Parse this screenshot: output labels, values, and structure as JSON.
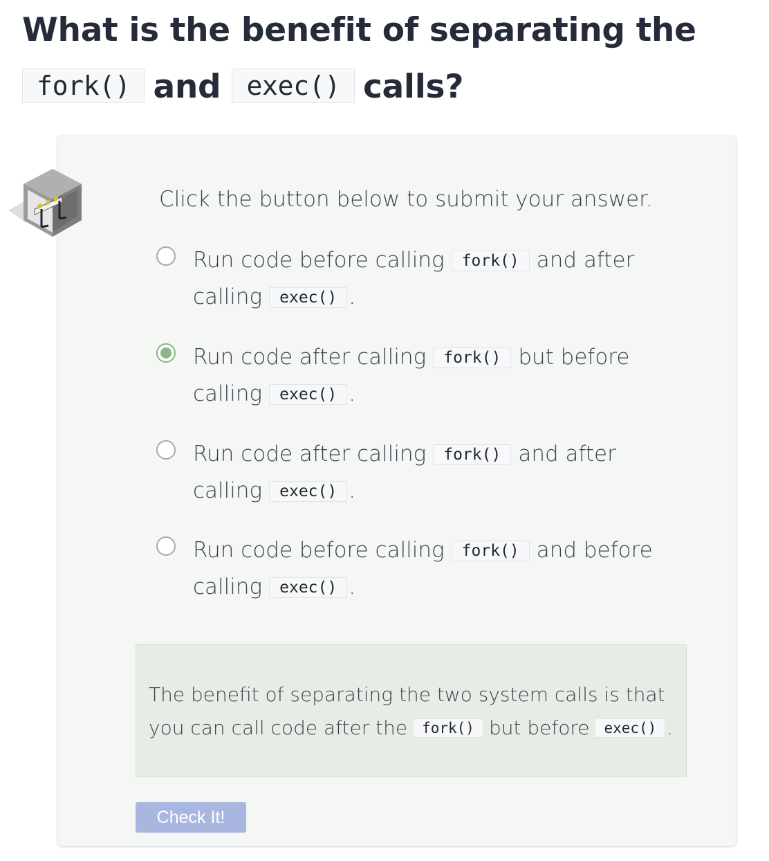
{
  "question": {
    "title_part1": "What is the benefit of separating the",
    "code1": "fork()",
    "title_and": "and",
    "code2": "exec()",
    "title_part2": "calls?"
  },
  "prompt": "Click the button below to submit your answer.",
  "options": [
    {
      "text_before": "Run code before calling",
      "code_a": "fork()",
      "text_mid": "and after calling",
      "code_b": "exec()",
      "text_end": ".",
      "selected": false
    },
    {
      "text_before": "Run code after calling",
      "code_a": "fork()",
      "text_mid": "but before calling",
      "code_b": "exec()",
      "text_end": ".",
      "selected": true
    },
    {
      "text_before": "Run code after calling",
      "code_a": "fork()",
      "text_mid": "and after calling",
      "code_b": "exec()",
      "text_end": ".",
      "selected": false
    },
    {
      "text_before": "Run code before calling",
      "code_a": "fork()",
      "text_mid": "and before calling",
      "code_b": "exec()",
      "text_end": ".",
      "selected": false
    }
  ],
  "feedback": {
    "text_before": "The benefit of separating the two system calls is that you can call code after the",
    "code_a": "fork()",
    "text_mid": "but before",
    "code_b": "exec()",
    "text_end": "."
  },
  "button": {
    "label": "Check It!"
  },
  "colors": {
    "selected_radio": "#86b784",
    "button_bg": "#a8b6e0",
    "feedback_bg": "#e7ede4",
    "card_bg": "#f5f7f5"
  }
}
